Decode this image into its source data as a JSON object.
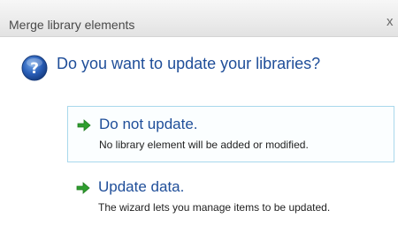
{
  "window": {
    "title": "Merge library elements",
    "close_label": "x"
  },
  "question": {
    "icon": "question-icon",
    "text": "Do you want to update your libraries?"
  },
  "options": [
    {
      "icon": "green-arrow-icon",
      "label": "Do not update.",
      "description": "No library element will be added or modified.",
      "selected": true
    },
    {
      "icon": "green-arrow-icon",
      "label": "Update data.",
      "description": "The wizard lets you manage items to be updated.",
      "selected": false
    }
  ],
  "colors": {
    "accent_text": "#1f4e99",
    "arrow_green": "#2e9e2e",
    "selection_border": "#a9d8ec"
  }
}
